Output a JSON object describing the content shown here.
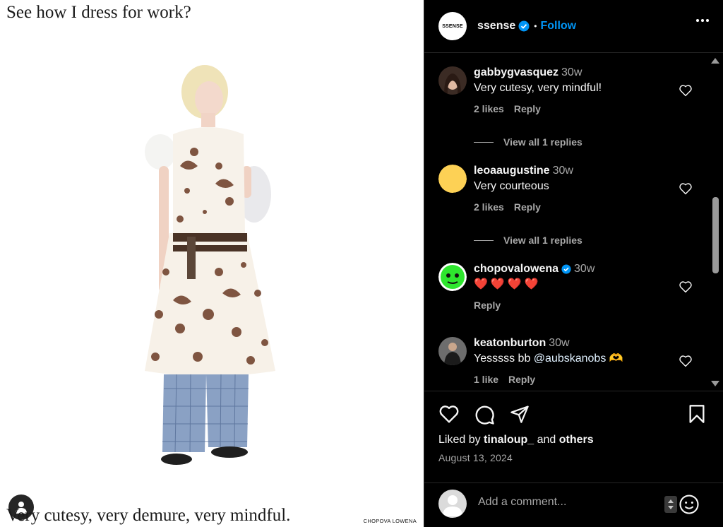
{
  "media": {
    "caption_top": "See how I dress for work?",
    "caption_bottom": "Very cutesy, very demure, very mindful.",
    "brand_mark": "CHOPOVA LOWENA"
  },
  "header": {
    "logo_text": "SSENSE",
    "username": "ssense",
    "separator": "•",
    "follow_label": "Follow"
  },
  "comments": [
    {
      "username": "gabbygvasquez",
      "time": "30w",
      "text": "Very cutesy, very mindful!",
      "likes": "2 likes",
      "reply": "Reply",
      "view_replies": "View all 1 replies",
      "avatar_color": "#3b2b24"
    },
    {
      "username": "leoaaugustine",
      "time": "30w",
      "text": "Very courteous",
      "likes": "2 likes",
      "reply": "Reply",
      "view_replies": "View all 1 replies",
      "avatar_color": "#fdd155"
    },
    {
      "username": "chopovalowena",
      "time": "30w",
      "text": "❤️❤️❤️❤️",
      "reply": "Reply",
      "avatar_color": "#2ee62e"
    },
    {
      "username": "keatonburton",
      "time": "30w",
      "text_prefix": "Yesssss bb ",
      "mention": "@aubskanobs",
      "text_suffix": " 🫶",
      "likes": "1 like",
      "reply": "Reply",
      "avatar_color": "#2c2c2c"
    }
  ],
  "actions": {
    "liked_prefix": "Liked by ",
    "liked_user": "tinaloup_",
    "liked_and": " and ",
    "liked_others": "others",
    "date": "August 13, 2024"
  },
  "composer": {
    "placeholder": "Add a comment..."
  },
  "icons": {
    "more": "more-options-icon",
    "like": "heart-icon",
    "comment": "comment-icon",
    "share": "share-icon",
    "save": "bookmark-icon",
    "emoji": "emoji-icon",
    "verified": "verified-badge-icon"
  },
  "colors": {
    "accent": "#0095f6",
    "verified": "#0095f6",
    "background": "#000000",
    "secondary_text": "#a8a8a8"
  }
}
